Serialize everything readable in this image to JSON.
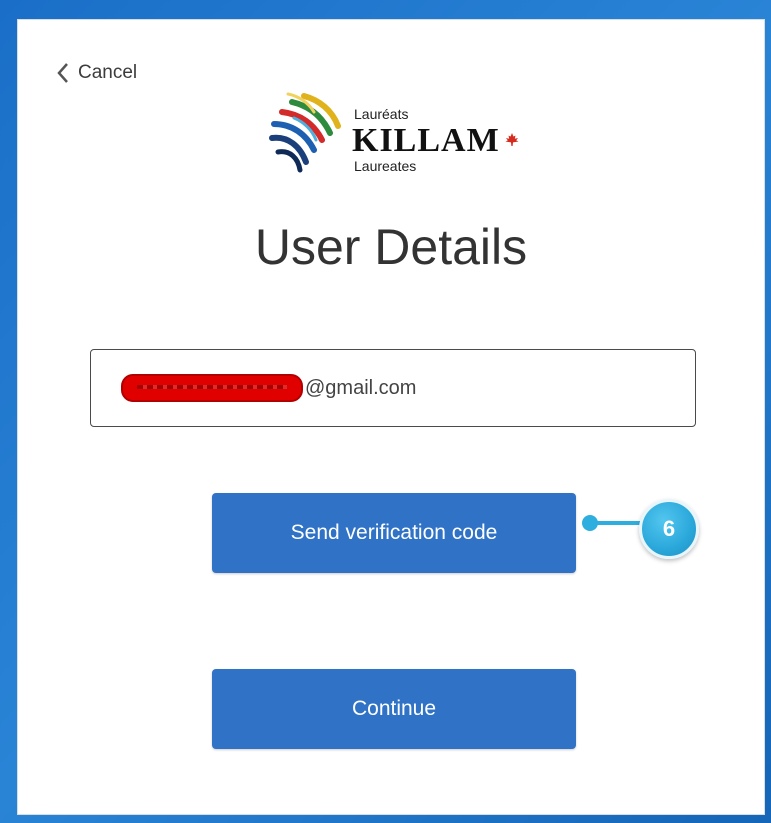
{
  "header": {
    "cancel_label": "Cancel",
    "logo": {
      "top_word": "Lauréats",
      "brand": "KILLAM",
      "bottom_word": "Laureates"
    }
  },
  "main": {
    "title": "User Details",
    "email_field": {
      "value_visible_suffix": "@gmail.com",
      "redacted": true
    },
    "buttons": {
      "send_verification_label": "Send verification code",
      "continue_label": "Continue"
    }
  },
  "annotation": {
    "step_number": "6"
  },
  "colors": {
    "frame_blue": "#1f72c8",
    "button_blue": "#2f72c6",
    "callout_blue": "#2eaede",
    "redaction_red": "#e10000"
  }
}
